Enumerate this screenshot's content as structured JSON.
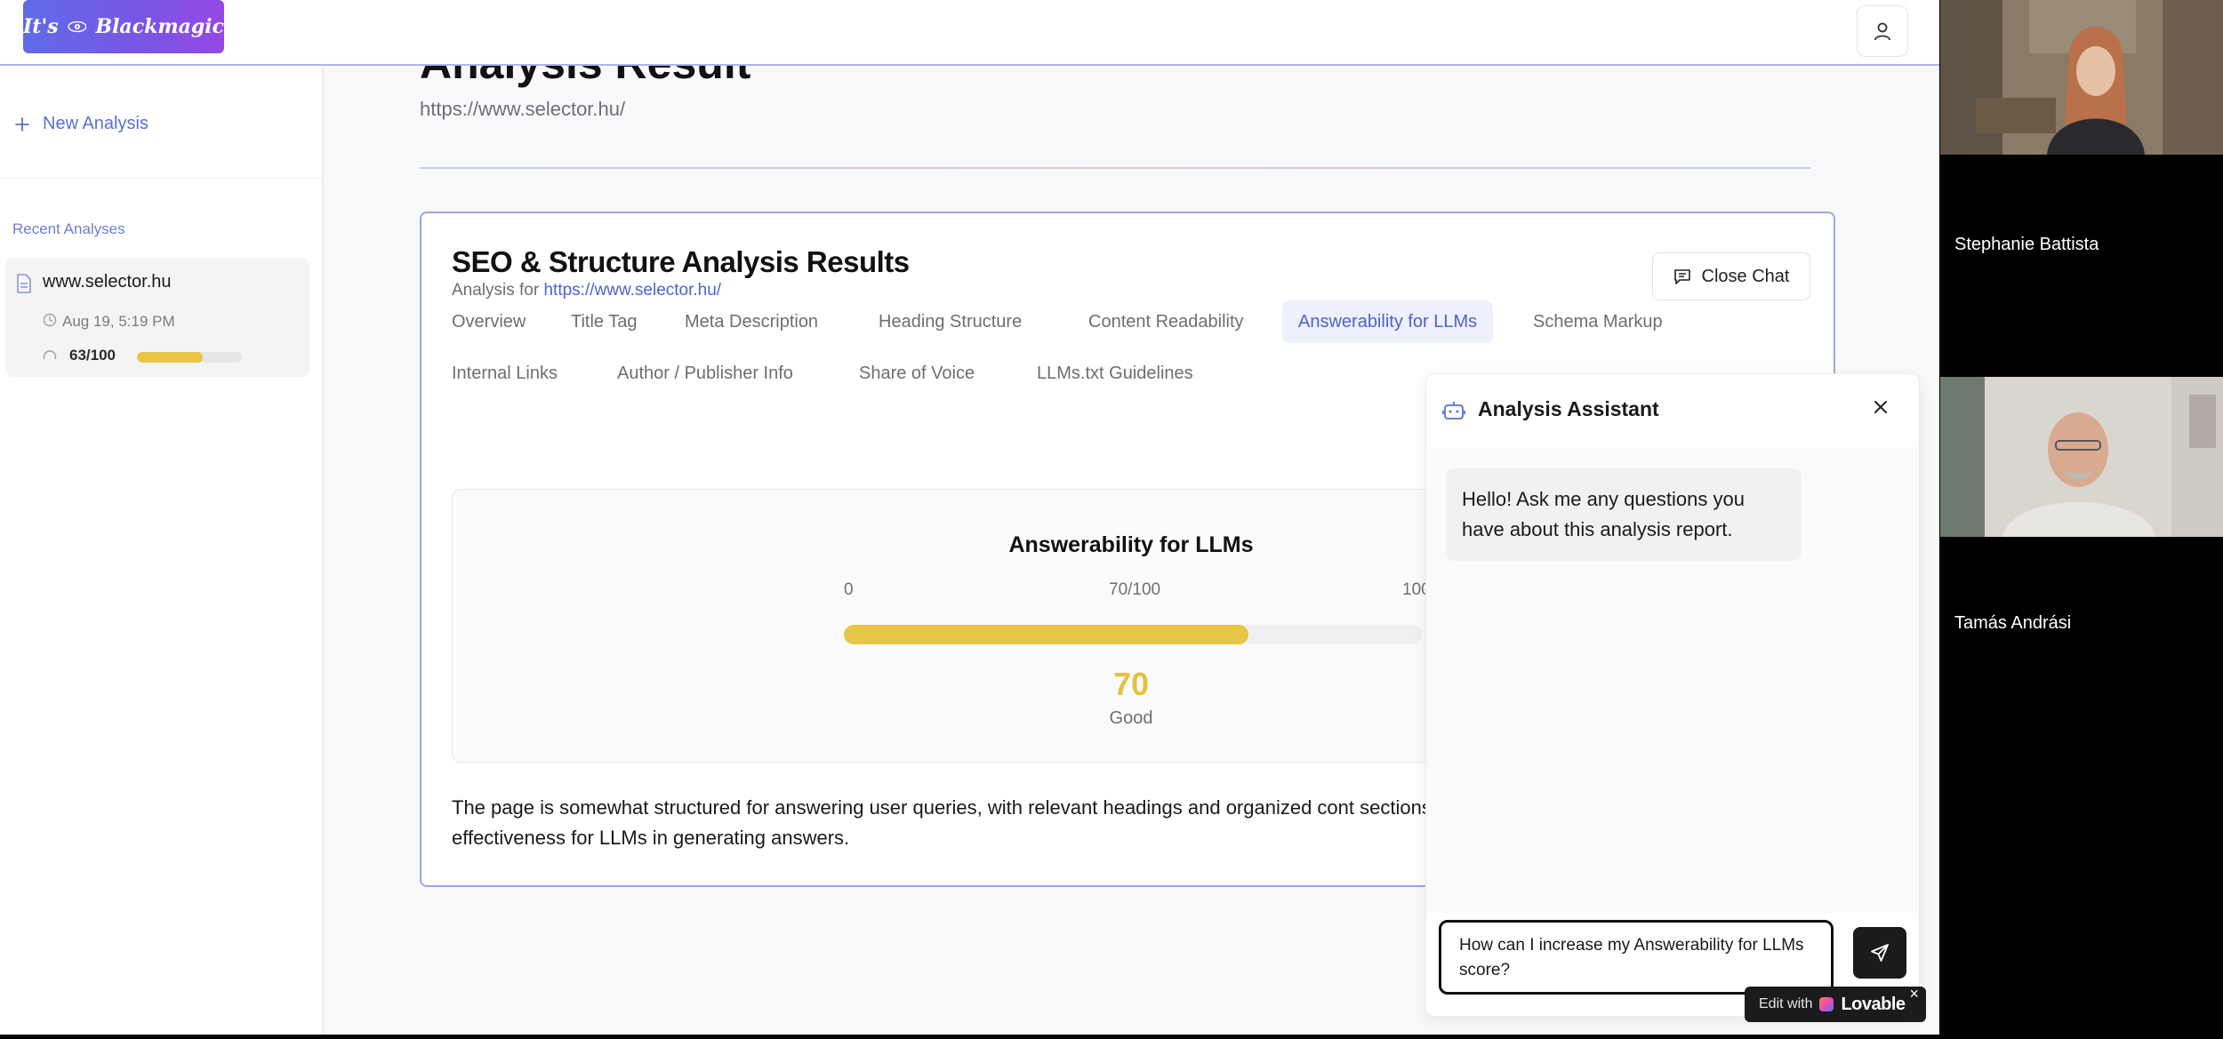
{
  "header": {
    "logo_text_left": "It's",
    "logo_text_right": "Blackmagic",
    "user_icon": "user-icon"
  },
  "sidebar": {
    "new_analysis": "New Analysis",
    "recent_label": "Recent Analyses",
    "recent": [
      {
        "title": "www.selector.hu",
        "date": "Aug 19, 5:19 PM",
        "score": "63/100",
        "score_fraction": 0.63
      }
    ]
  },
  "main": {
    "title": "Analysis Result",
    "url": "https://www.selector.hu/",
    "card": {
      "heading": "SEO & Structure Analysis Results",
      "sub_prefix": "Analysis for ",
      "sub_link": "https://www.selector.hu/",
      "close_chat": "Close Chat",
      "tabs_row1": [
        "Overview",
        "Title Tag",
        "Meta Description",
        "Heading Structure",
        "Content Readability",
        "Answerability for LLMs",
        "Schema Markup"
      ],
      "tabs_row2": [
        "Internal Links",
        "Author / Publisher Info",
        "Share of Voice",
        "LLMs.txt Guidelines"
      ],
      "active_tab": "Answerability for LLMs",
      "score_panel": {
        "title": "Answerability for LLMs",
        "min": "0",
        "current": "70/100",
        "max": "100",
        "score": "70",
        "score_fraction": 0.7,
        "rating": "Good"
      },
      "summary": "The page is somewhat structured for answering user queries, with relevant headings and organized cont sections or structured data could improve its effectiveness for LLMs in generating answers."
    }
  },
  "chat": {
    "title": "Analysis Assistant",
    "message": "Hello! Ask me any questions you have about this analysis report.",
    "input_value": "How can I increase my Answerability for LLMs score?"
  },
  "lovable": {
    "edit": "Edit with",
    "brand": "Lovable"
  },
  "participants": [
    {
      "name": "Stephanie Battista"
    },
    {
      "name": "Tamás Andrási"
    }
  ],
  "colors": {
    "accent": "#4d63cc",
    "score_yellow": "#e8c544",
    "logo_gradient_start": "#5f6be8",
    "logo_gradient_end": "#9448e6"
  }
}
